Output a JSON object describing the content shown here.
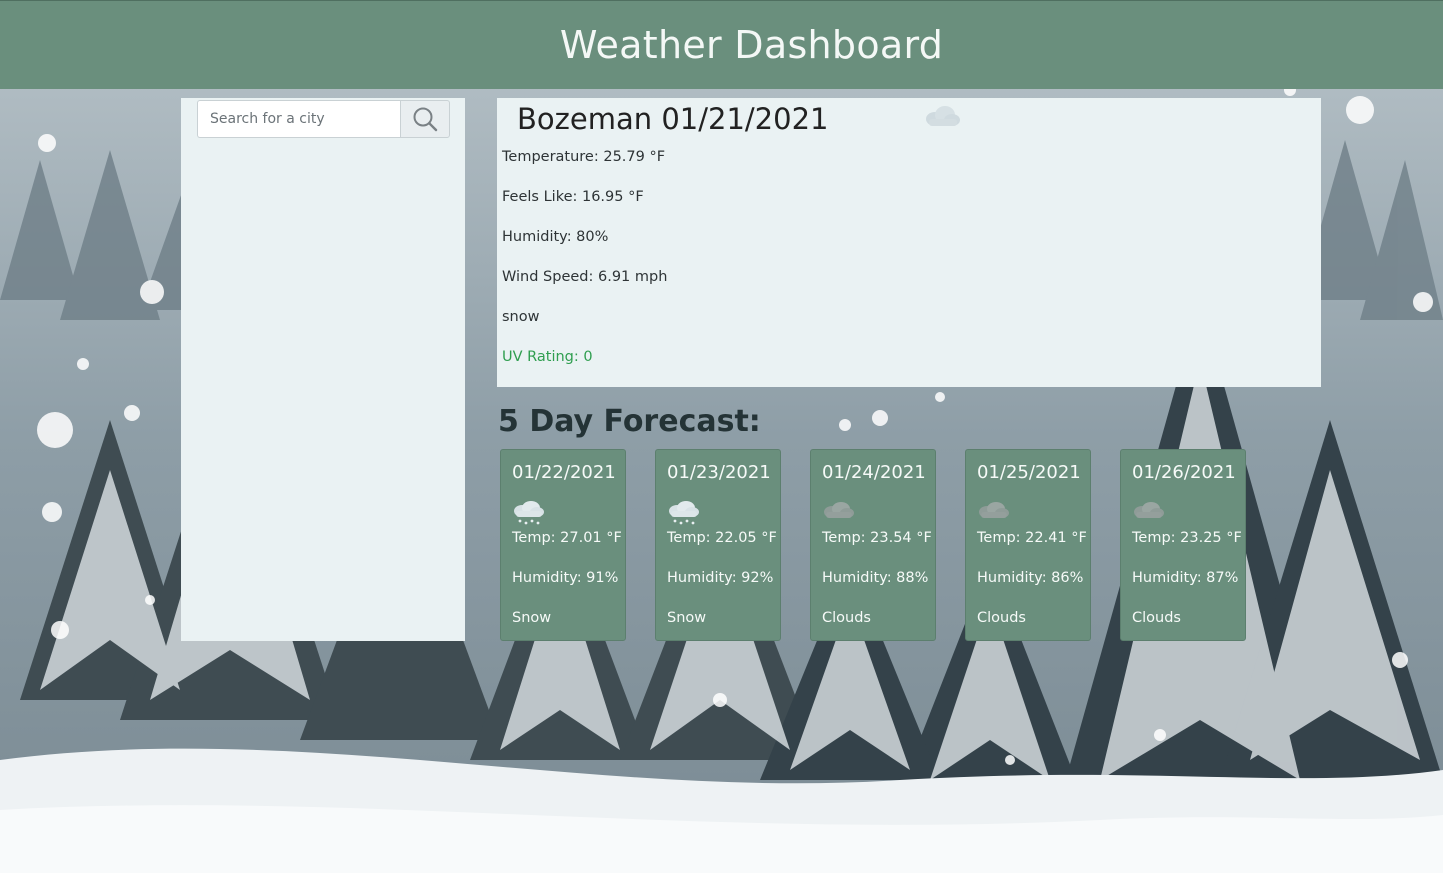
{
  "header": {
    "title": "Weather Dashboard"
  },
  "search": {
    "placeholder": "Search for a city",
    "button_icon": "search-icon"
  },
  "current": {
    "city_date": "Bozeman 01/21/2021",
    "icon": "snow-cloud-icon",
    "temperature": "Temperature: 25.79 °F",
    "feels_like": "Feels Like: 16.95 °F",
    "humidity": "Humidity: 80%",
    "wind": "Wind Speed: 6.91 mph",
    "description": "snow",
    "uv": "UV Rating: 0",
    "uv_color": "#2f9e4f"
  },
  "forecast": {
    "title": "5 Day Forecast:",
    "days": [
      {
        "date": "01/22/2021",
        "icon": "snow-icon",
        "temp": "Temp: 27.01 °F",
        "humidity": "Humidity: 91%",
        "condition": "Snow"
      },
      {
        "date": "01/23/2021",
        "icon": "snow-icon",
        "temp": "Temp: 22.05 °F",
        "humidity": "Humidity: 92%",
        "condition": "Snow"
      },
      {
        "date": "01/24/2021",
        "icon": "clouds-icon",
        "temp": "Temp: 23.54 °F",
        "humidity": "Humidity: 88%",
        "condition": "Clouds"
      },
      {
        "date": "01/25/2021",
        "icon": "clouds-icon",
        "temp": "Temp: 22.41 °F",
        "humidity": "Humidity: 86%",
        "condition": "Clouds"
      },
      {
        "date": "01/26/2021",
        "icon": "clouds-icon",
        "temp": "Temp: 23.25 °F",
        "humidity": "Humidity: 87%",
        "condition": "Clouds"
      }
    ]
  },
  "colors": {
    "header_bg": "#6a8f7d",
    "panel_bg": "#eaf2f3",
    "card_bg": "#6a8f7d"
  }
}
